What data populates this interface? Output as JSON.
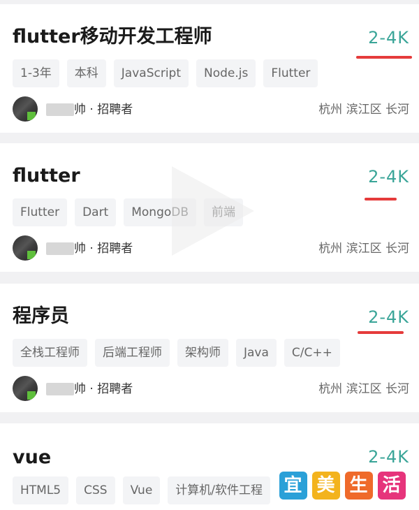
{
  "jobs": [
    {
      "title": "flutter移动开发工程师",
      "salary": "2-4K",
      "tags": [
        "1-3年",
        "本科",
        "JavaScript",
        "Node.js",
        "Flutter"
      ],
      "recruiter": "帅 · 招聘者",
      "location": "杭州 滨江区 长河"
    },
    {
      "title": "flutter",
      "salary": "2-4K",
      "tags": [
        "Flutter",
        "Dart",
        "MongoDB",
        "前端"
      ],
      "recruiter": "帅 · 招聘者",
      "location": "杭州 滨江区 长河"
    },
    {
      "title": "程序员",
      "salary": "2-4K",
      "tags": [
        "全栈工程师",
        "后端工程师",
        "架构师",
        "Java",
        "C/C++"
      ],
      "recruiter": "帅 · 招聘者",
      "location": "杭州 滨江区 长河"
    },
    {
      "title": "vue",
      "salary": "2-4K",
      "tags": [
        "HTML5",
        "CSS",
        "Vue",
        "计算机/软件工程"
      ]
    }
  ],
  "watermark": {
    "chars": [
      "宜",
      "美",
      "生",
      "活"
    ],
    "colors": [
      "#2aa0d8",
      "#f3b31d",
      "#ef6a2a",
      "#e6347b"
    ]
  },
  "colors": {
    "salary": "#3aa598",
    "underline": "#e53b3b",
    "tag_bg": "#f3f4f6"
  }
}
